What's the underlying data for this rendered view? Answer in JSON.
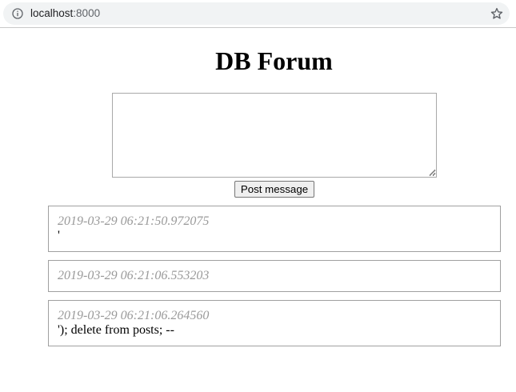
{
  "browser": {
    "url_host": "localhost",
    "url_port": ":8000",
    "info_icon": "info-circle-icon",
    "bookmark_icon": "star-outline-icon"
  },
  "page": {
    "title": "DB Forum"
  },
  "form": {
    "message_value": "",
    "post_button_label": "Post message"
  },
  "posts": [
    {
      "time": "2019-03-29 06:21:50.972075",
      "content": "'"
    },
    {
      "time": "2019-03-29 06:21:06.553203",
      "content": ""
    },
    {
      "time": "2019-03-29 06:21:06.264560",
      "content": "'); delete from posts; --"
    }
  ],
  "colors": {
    "timestamp": "#9a9a9a",
    "post_border": "#a0a0a0",
    "omnibox_bg": "#f1f3f4"
  }
}
